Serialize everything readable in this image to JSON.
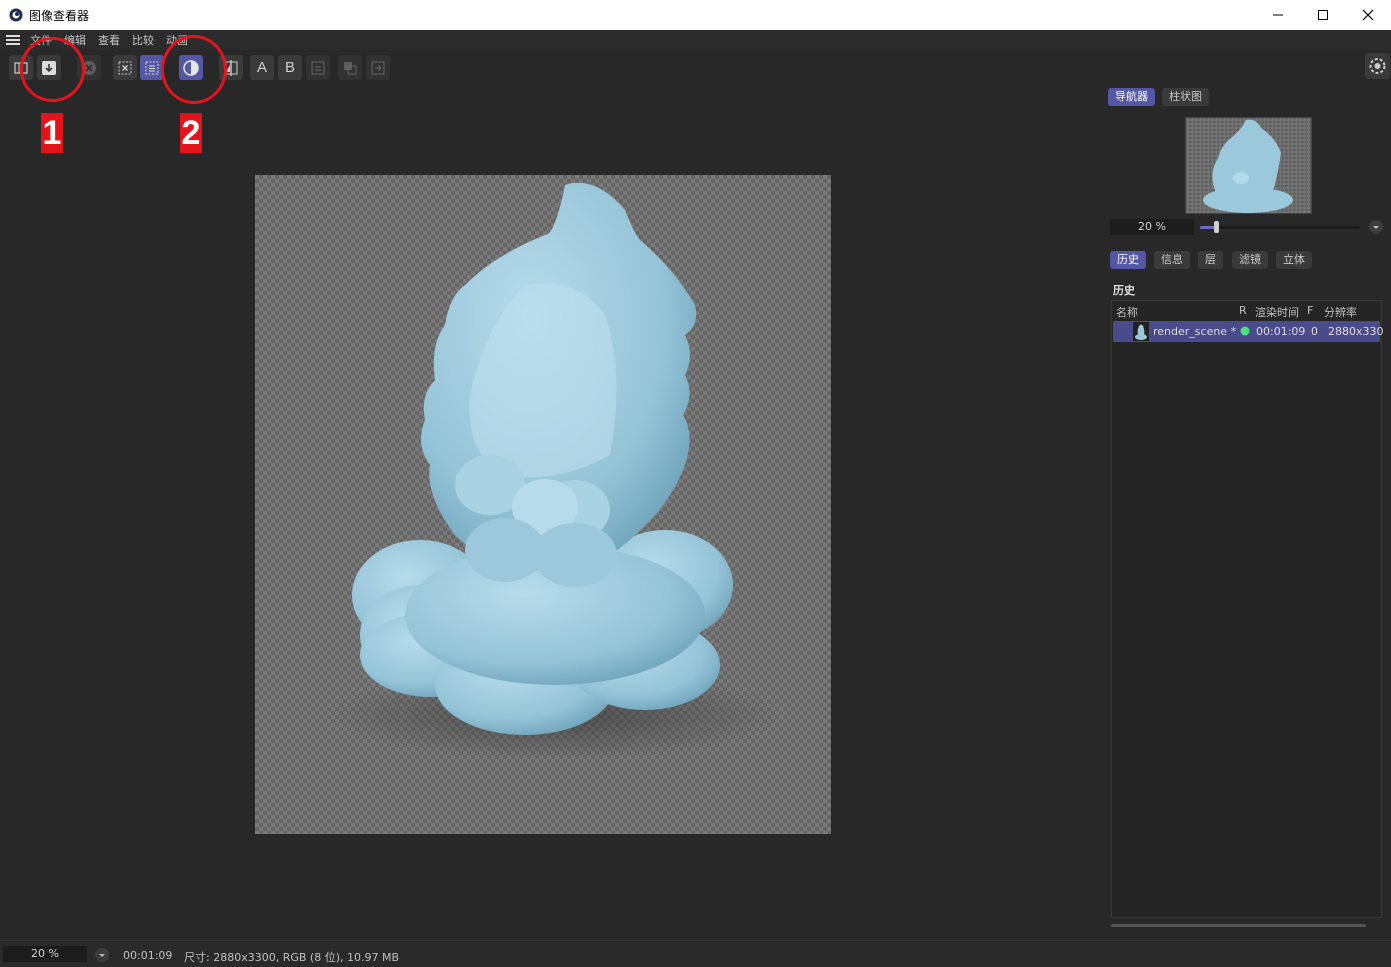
{
  "window": {
    "title": "图像查看器",
    "minimize": "—",
    "maximize": "☐",
    "close": "✕"
  },
  "menu": {
    "items": [
      "文件",
      "编辑",
      "查看",
      "比较",
      "动画"
    ]
  },
  "toolbar": {
    "text_a": "A",
    "text_b": "B"
  },
  "annotations": {
    "label1": "1",
    "label2": "2",
    "color": "#e4141d"
  },
  "navigator": {
    "tabs": [
      "导航器",
      "柱状图"
    ],
    "zoom": "20 %",
    "zoom_level": 0.1
  },
  "info_tabs": [
    "历史",
    "信息",
    "层",
    "滤镜",
    "立体"
  ],
  "history": {
    "title": "历史",
    "columns": [
      "名称",
      "R",
      "渲染时间",
      "F",
      "分辨率"
    ],
    "rows": [
      {
        "name": "render_scene *",
        "time": "00:01:09",
        "frame": "0",
        "resolution": "2880x330"
      }
    ]
  },
  "status": {
    "zoom": "20 %",
    "time": "00:01:09",
    "info": "尺寸: 2880x3300, RGB (8 位), 10.97 MB"
  },
  "colors": {
    "accent": "#5457a3",
    "background": "#282828",
    "subject": "#9fc7dc"
  }
}
